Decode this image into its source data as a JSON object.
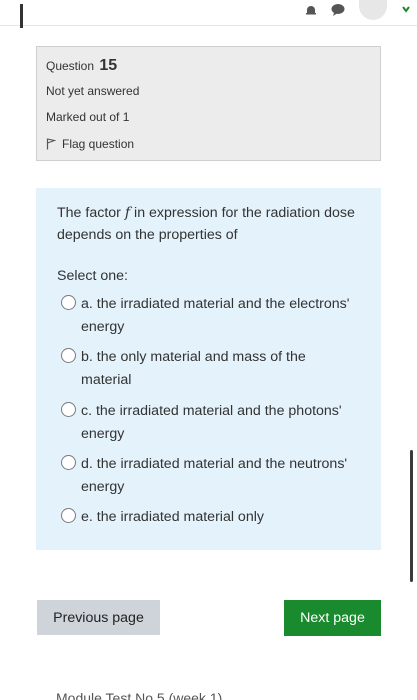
{
  "question": {
    "label": "Question",
    "number": "15",
    "state": "Not yet answered",
    "grade": "Marked out of 1",
    "flag_label": "Flag question"
  },
  "content": {
    "prompt_before": "The factor ",
    "prompt_var": "f",
    "prompt_after": " in expression for the radiation dose depends on the properties of",
    "select_one": "Select one:",
    "options": [
      {
        "label": "a. the irradiated material and the electrons' energy",
        "selected": false
      },
      {
        "label": "b. the only material and mass of the material",
        "selected": false
      },
      {
        "label": "c. the irradiated material and the photons' energy",
        "selected": false
      },
      {
        "label": "d. the irradiated material and the neutrons' energy",
        "selected": false
      },
      {
        "label": "e. the irradiated material only",
        "selected": false
      }
    ]
  },
  "navigation": {
    "previous_label": "Previous page",
    "next_label": "Next page",
    "cutoff_link_text": "Module Test No 5 (week 1)"
  },
  "colors": {
    "info_bg": "#ececec",
    "content_bg": "#e3f2fb",
    "next_button": "#1a8a2f",
    "prev_button": "#ced4da"
  }
}
